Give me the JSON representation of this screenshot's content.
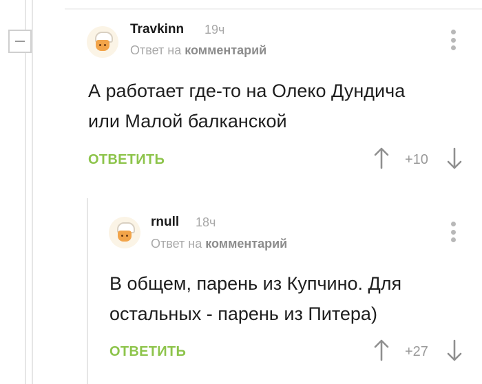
{
  "comments": [
    {
      "username": "Travkinn",
      "time": "19ч",
      "reply_prefix": "Ответ на",
      "reply_target": "комментарий",
      "text_line1": "А работает где-то на Олеко Дундича",
      "text_line2": "или Малой балканской",
      "reply_label": "ОТВЕТИТЬ",
      "rating": "+10"
    },
    {
      "username": "rnull",
      "time": "18ч",
      "reply_prefix": "Ответ на",
      "reply_target": "комментарий",
      "text_line1": "В общем, парень из Купчино. Для",
      "text_line2": "остальных - парень из Питера)",
      "reply_label": "ОТВЕТИТЬ",
      "rating": "+27"
    }
  ],
  "colors": {
    "accent": "#8dc44b",
    "muted": "#a8a8a8",
    "text": "#1e1e1e"
  },
  "icons": [
    "collapse-icon",
    "avatar",
    "more-icon",
    "arrow-up-icon",
    "arrow-down-icon"
  ]
}
